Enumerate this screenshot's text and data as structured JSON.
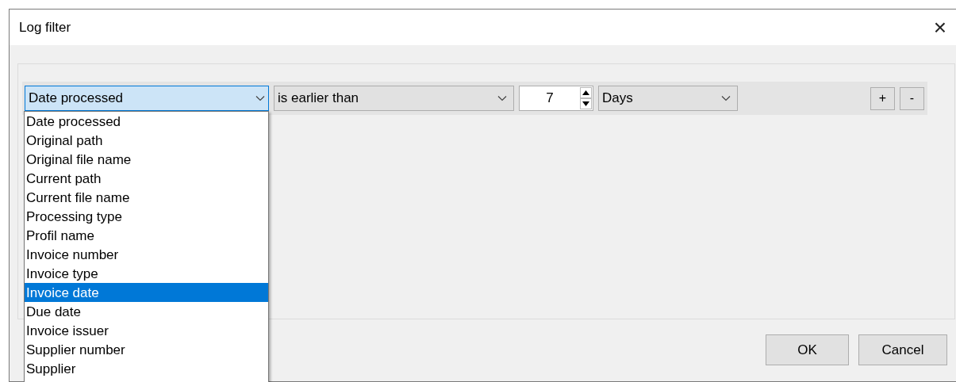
{
  "window": {
    "title": "Log filter",
    "close": "×"
  },
  "filter_row": {
    "field": {
      "value": "Date processed",
      "expanded": true
    },
    "operator": {
      "value": "is earlier than"
    },
    "amount": {
      "value": "7"
    },
    "unit": {
      "value": "Days"
    },
    "add": "+",
    "remove": "-"
  },
  "field_options": [
    {
      "label": "Date processed",
      "selected": false
    },
    {
      "label": "Original path",
      "selected": false
    },
    {
      "label": "Original file name",
      "selected": false
    },
    {
      "label": "Current path",
      "selected": false
    },
    {
      "label": "Current file name",
      "selected": false
    },
    {
      "label": "Processing type",
      "selected": false
    },
    {
      "label": "Profil name",
      "selected": false
    },
    {
      "label": "Invoice number",
      "selected": false
    },
    {
      "label": "Invoice type",
      "selected": false
    },
    {
      "label": "Invoice date",
      "selected": true
    },
    {
      "label": "Due date",
      "selected": false
    },
    {
      "label": "Invoice issuer",
      "selected": false
    },
    {
      "label": "Supplier number",
      "selected": false
    },
    {
      "label": "Supplier",
      "selected": false
    }
  ],
  "buttons": [
    "OK",
    "Cancel"
  ]
}
